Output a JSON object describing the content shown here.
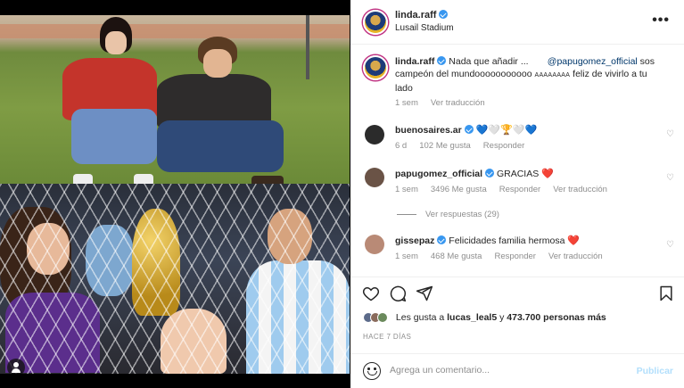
{
  "post": {
    "username": "linda.raff",
    "location": "Lusail Stadium",
    "more_label": "•••"
  },
  "caption": {
    "username": "linda.raff",
    "text_before": "Nada que añadir ... ⠀⠀ ",
    "mention": "@papugomez_official",
    "text_middle": " sos campeón del mundooooooooooo ",
    "small_text": "AAAAAAAA",
    "text_after": " feliz de vivirlo a tu lado",
    "time": "1 sem",
    "translate": "Ver traducción"
  },
  "comments": [
    {
      "username": "buenosaires.ar",
      "text": "",
      "emojis": [
        "💙",
        "🤍",
        "🏆",
        "🤍",
        "💙"
      ],
      "time": "6 d",
      "likes": "102 Me gusta",
      "reply": "Responder",
      "translate": "",
      "avatar_color": "#2b2b2b"
    },
    {
      "username": "papugomez_official",
      "text": "GRACIAS",
      "emojis": [
        "❤️"
      ],
      "time": "1 sem",
      "likes": "3496 Me gusta",
      "reply": "Responder",
      "translate": "Ver traducción",
      "avatar_color": "#6a5346"
    },
    {
      "username": "gissepaz",
      "text": "Felicidades familia hermosa",
      "emojis": [
        "❤️"
      ],
      "time": "1 sem",
      "likes": "468 Me gusta",
      "reply": "Responder",
      "translate": "Ver traducción",
      "avatar_color": "#b98a76"
    }
  ],
  "replies_label": "Ver respuestas (29)",
  "likes": {
    "prefix": "Les gusta a ",
    "user": "lucas_leal5",
    "middle": " y ",
    "count": "473.700 personas más"
  },
  "time_ago": "HACE 7 DÍAS",
  "comment_box": {
    "placeholder": "Agrega un comentario...",
    "publish": "Publicar"
  },
  "colors": {
    "verified": "#3897f0",
    "mention": "#00376b",
    "heart": "#ed4956",
    "publish_disabled": "#b2dffc"
  }
}
